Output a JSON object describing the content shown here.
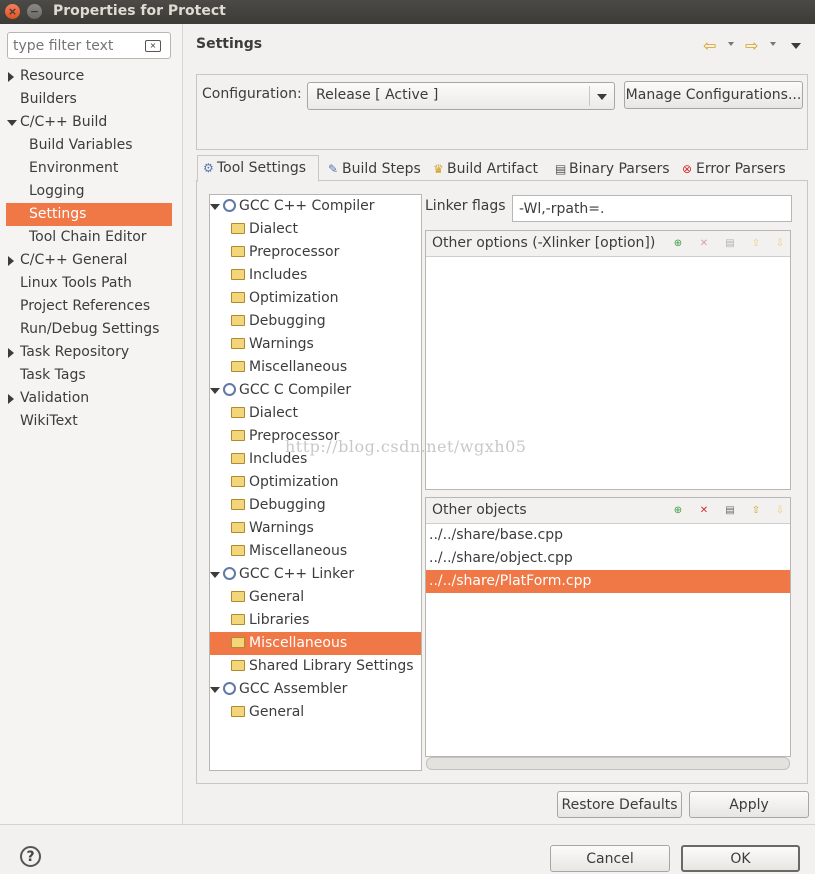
{
  "window": {
    "title": "Properties for Protect"
  },
  "filter": {
    "placeholder": "type filter text"
  },
  "nav": {
    "items": [
      {
        "label": "Resource",
        "expandable": true
      },
      {
        "label": "Builders"
      },
      {
        "label": "C/C++ Build",
        "expanded": true
      },
      {
        "label": "Build Variables",
        "child": true
      },
      {
        "label": "Environment",
        "child": true
      },
      {
        "label": "Logging",
        "child": true
      },
      {
        "label": "Settings",
        "child": true,
        "selected": true
      },
      {
        "label": "Tool Chain Editor",
        "child": true
      },
      {
        "label": "C/C++ General",
        "expandable": true
      },
      {
        "label": "Linux Tools Path"
      },
      {
        "label": "Project References"
      },
      {
        "label": "Run/Debug Settings"
      },
      {
        "label": "Task Repository",
        "expandable": true
      },
      {
        "label": "Task Tags"
      },
      {
        "label": "Validation",
        "expandable": true
      },
      {
        "label": "WikiText"
      }
    ]
  },
  "header": {
    "title": "Settings"
  },
  "configuration": {
    "label": "Configuration:",
    "value": "Release  [ Active ]",
    "manage_label": "Manage Configurations..."
  },
  "tabs": [
    {
      "label": "Tool Settings",
      "active": true
    },
    {
      "label": "Build Steps"
    },
    {
      "label": "Build Artifact"
    },
    {
      "label": "Binary Parsers"
    },
    {
      "label": "Error Parsers"
    }
  ],
  "tree": {
    "groups": [
      {
        "label": "GCC C++ Compiler",
        "children": [
          "Dialect",
          "Preprocessor",
          "Includes",
          "Optimization",
          "Debugging",
          "Warnings",
          "Miscellaneous"
        ]
      },
      {
        "label": "GCC C Compiler",
        "children": [
          "Dialect",
          "Preprocessor",
          "Includes",
          "Optimization",
          "Debugging",
          "Warnings",
          "Miscellaneous"
        ]
      },
      {
        "label": "GCC C++ Linker",
        "children": [
          "General",
          "Libraries",
          "Miscellaneous",
          "Shared Library Settings"
        ]
      },
      {
        "label": "GCC Assembler",
        "children": [
          "General"
        ]
      }
    ],
    "selected": "GCC C++ Linker/Miscellaneous"
  },
  "linker": {
    "flags_label": "Linker flags",
    "flags_value": "-Wl,-rpath=."
  },
  "other_options": {
    "header": "Other options (-Xlinker [option])",
    "items": []
  },
  "other_objects": {
    "header": "Other objects",
    "items": [
      "../../share/base.cpp",
      "../../share/object.cpp",
      "../../share/PlatForm.cpp"
    ],
    "selected_index": 2
  },
  "watermark": "http://blog.csdn.net/wgxh05",
  "buttons": {
    "restore_defaults": "Restore Defaults",
    "apply": "Apply",
    "cancel": "Cancel",
    "ok": "OK"
  },
  "icons": {
    "help": "?",
    "close": "×",
    "minimize": "−"
  },
  "colors": {
    "selection": "#f07746",
    "titlebar": "#3c3b37"
  }
}
